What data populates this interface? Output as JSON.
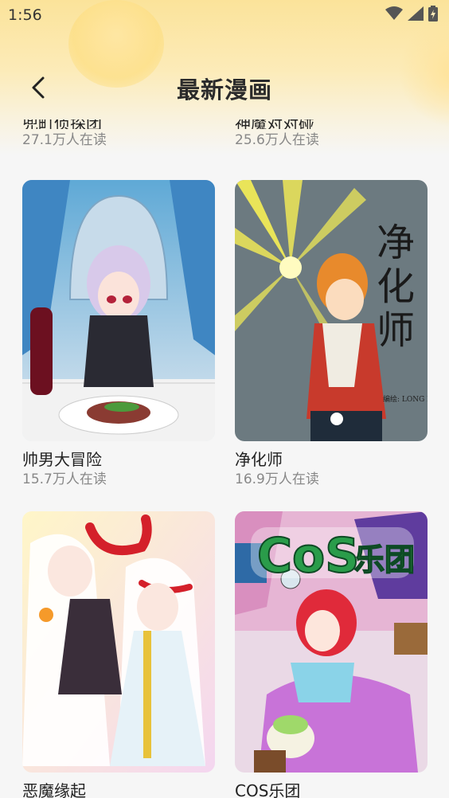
{
  "status_bar": {
    "time": "1:56"
  },
  "header": {
    "title": "最新漫画"
  },
  "comics": [
    {
      "title": "兜町侦探团",
      "readers": "27.1万人在读"
    },
    {
      "title": "神魔对对碰",
      "readers": "25.6万人在读"
    },
    {
      "title": "帅男大冒险",
      "readers": "15.7万人在读"
    },
    {
      "title": "净化师",
      "readers": "16.9万人在读",
      "cover_text": "净化师",
      "cover_credit": "编绘: LONG LONG"
    },
    {
      "title": "恶魔缘起",
      "readers": ""
    },
    {
      "title": "COS乐团",
      "readers": "",
      "cover_text": "COS乐团"
    }
  ],
  "colors": {
    "accent": "#fbe39a",
    "title": "#2b2b2b",
    "sub": "#888888"
  }
}
